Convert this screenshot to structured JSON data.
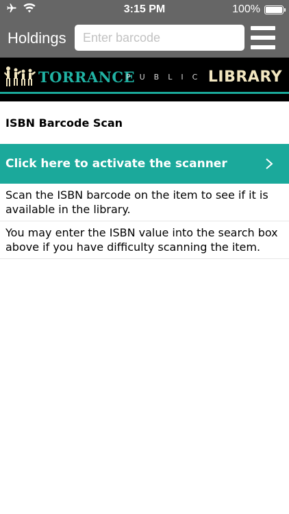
{
  "status_bar": {
    "time": "3:15 PM",
    "battery_percent": "100%",
    "battery_level": 1.0,
    "icons": [
      "airplane-icon",
      "wifi-icon",
      "battery-icon"
    ]
  },
  "nav": {
    "title": "Holdings",
    "search_placeholder": "Enter barcode",
    "search_value": "",
    "menu_icon": "hamburger-menu-icon"
  },
  "banner": {
    "torrance": "TORRANCE",
    "public": "PUBLIC",
    "library": "LIBRARY"
  },
  "content": {
    "section_title": "ISBN Barcode Scan",
    "scanner_button_label": "Click here to activate the scanner",
    "info_items": [
      "Scan the ISBN barcode on the item to see if it is available in the library.",
      "You may enter the ISBN value into the search box above if you have difficulty scanning the item."
    ]
  },
  "colors": {
    "header_gray": "#666666",
    "accent_teal": "#1ba99b",
    "banner_black": "#000000",
    "library_cream": "#f2e6c0"
  }
}
